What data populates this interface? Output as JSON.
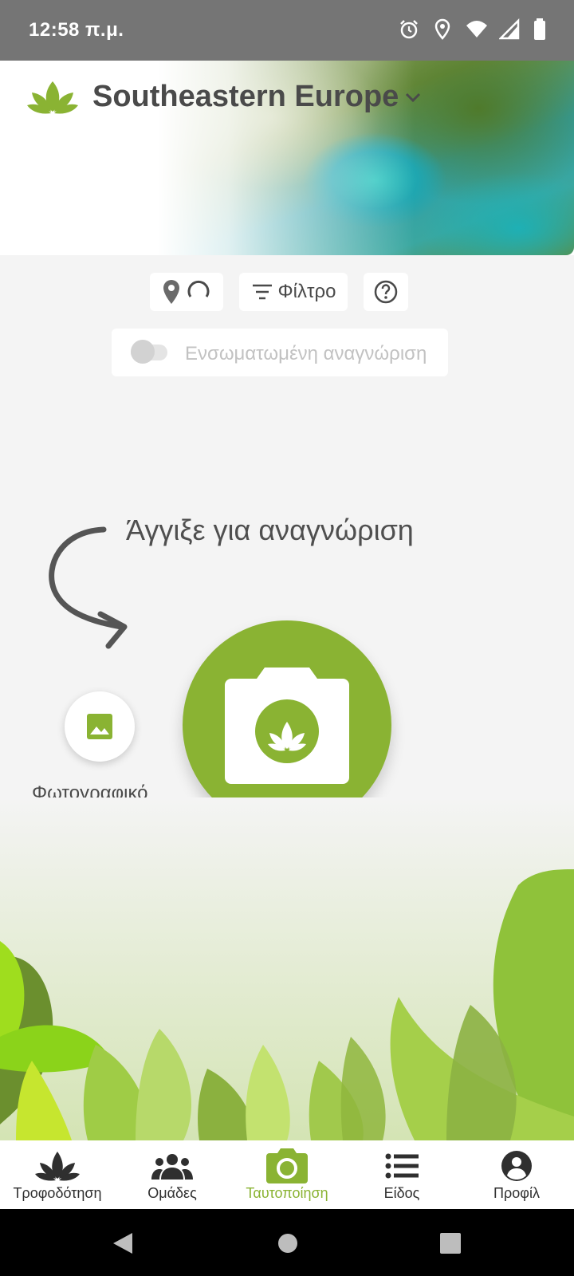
{
  "status_bar": {
    "time": "12:58 π.μ."
  },
  "header": {
    "region": "Southeastern Europe"
  },
  "toolbar": {
    "filter_label": "Φίλτρο"
  },
  "offline": {
    "label": "Ενσωματωμένη αναγνώριση",
    "enabled": false
  },
  "main": {
    "tap_hint": "Άγγιξε για αναγνώριση",
    "gallery_label": "Φωτογραφικό αρχείο"
  },
  "bottom_nav": {
    "items": [
      {
        "label": "Τροφοδότηση",
        "icon": "plant-icon"
      },
      {
        "label": "Ομάδες",
        "icon": "groups-icon"
      },
      {
        "label": "Ταυτοποίηση",
        "icon": "camera-icon",
        "active": true
      },
      {
        "label": "Είδος",
        "icon": "list-icon"
      },
      {
        "label": "Προφίλ",
        "icon": "account-icon"
      }
    ]
  },
  "colors": {
    "accent": "#8ab333",
    "text": "#4a4a4a",
    "status_bar": "#757575"
  }
}
